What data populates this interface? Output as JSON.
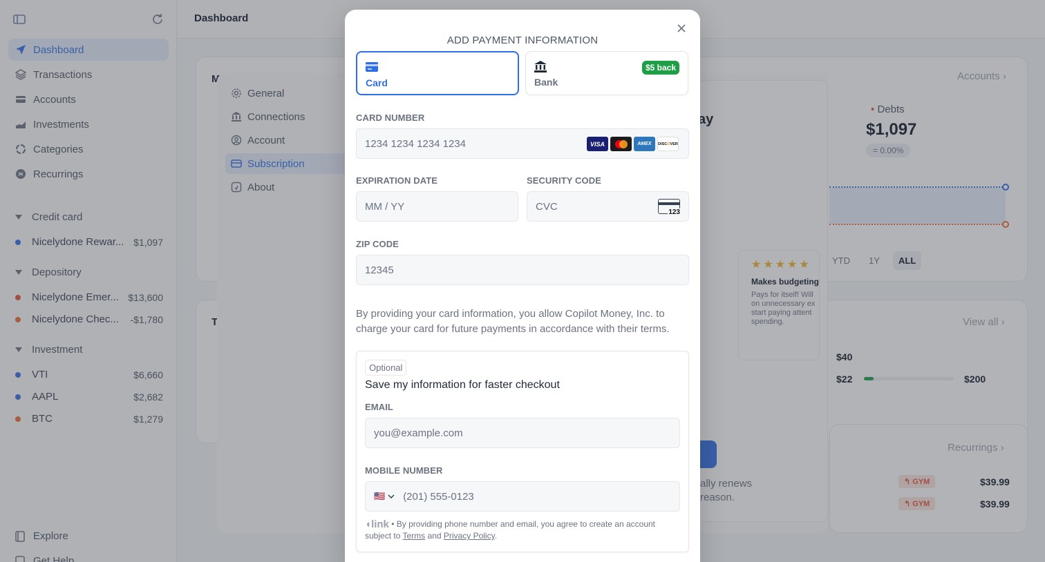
{
  "app": {
    "page_title": "Dashboard",
    "nav": [
      {
        "label": "Dashboard",
        "icon": "paper-plane-icon",
        "active": true
      },
      {
        "label": "Transactions",
        "icon": "layers-icon",
        "active": false
      },
      {
        "label": "Accounts",
        "icon": "card-icon",
        "active": false
      },
      {
        "label": "Investments",
        "icon": "chart-icon",
        "active": false
      },
      {
        "label": "Categories",
        "icon": "categories-icon",
        "active": false
      },
      {
        "label": "Recurrings",
        "icon": "recurring-icon",
        "active": false
      }
    ],
    "groups": [
      {
        "label": "Credit card",
        "accounts": [
          {
            "name": "Nicelydone Rewar...",
            "amount": "$1,097",
            "color": "#2f6fe6"
          }
        ]
      },
      {
        "label": "Depository",
        "accounts": [
          {
            "name": "Nicelydone Emer...",
            "amount": "$13,600",
            "color": "#e5533d"
          },
          {
            "name": "Nicelydone Chec...",
            "amount": "-$1,780",
            "color": "#ef6c2f"
          }
        ]
      },
      {
        "label": "Investment",
        "accounts": [
          {
            "name": "VTI",
            "amount": "$6,660",
            "color": "#2f6fe6"
          },
          {
            "name": "AAPL",
            "amount": "$2,682",
            "color": "#2f6fe6"
          },
          {
            "name": "BTC",
            "amount": "$1,279",
            "color": "#ef6c2f"
          }
        ]
      }
    ],
    "bottom": [
      {
        "label": "Explore"
      },
      {
        "label": "Get Help"
      }
    ],
    "bg": {
      "accounts_link": "Accounts",
      "debts_label": "Debts",
      "debts_value": "$1,097",
      "debts_change": "= 0.00%",
      "ranges": [
        "YTD",
        "1Y",
        "ALL"
      ],
      "view_all": "View all",
      "budget_left": "$40",
      "budget_spent": "$22",
      "budget_total": "$200",
      "recurrings_link": "Recurrings",
      "recurrings": [
        {
          "tag": "GYM",
          "amount": "$39.99"
        },
        {
          "tag": "GYM",
          "amount": "$39.99"
        }
      ],
      "review_title": "Makes budgeting",
      "review_body": "Pays for itself! Will on unnecessary ex start paying attent spending.",
      "stars": "★★★★★",
      "frag_ay": "ay",
      "frag_renews": "ally renews",
      "frag_reason": "reason.",
      "frag_m": "M",
      "frag_t": "T"
    }
  },
  "settings": {
    "items": [
      {
        "label": "General",
        "icon": "gear-icon"
      },
      {
        "label": "Connections",
        "icon": "bank-icon"
      },
      {
        "label": "Account",
        "icon": "user-circle-icon"
      },
      {
        "label": "Subscription",
        "icon": "card-icon",
        "active": true
      },
      {
        "label": "About",
        "icon": "info-icon"
      }
    ]
  },
  "modal": {
    "title": "ADD PAYMENT INFORMATION",
    "tabs": {
      "card": {
        "label": "Card",
        "icon": "credit-card-icon",
        "selected": true
      },
      "bank": {
        "label": "Bank",
        "icon": "bank-icon",
        "badge": "$5 back"
      }
    },
    "card_number": {
      "label": "CARD NUMBER",
      "placeholder": "1234 1234 1234 1234",
      "brands": [
        "VISA",
        "Mastercard",
        "AMEX",
        "DISCOVER"
      ]
    },
    "expiration": {
      "label": "EXPIRATION DATE",
      "placeholder": "MM / YY"
    },
    "security": {
      "label": "SECURITY CODE",
      "placeholder": "CVC",
      "icon_text": "123"
    },
    "zip": {
      "label": "ZIP CODE",
      "placeholder": "12345"
    },
    "consent": "By providing your card information, you allow Copilot Money, Inc. to charge your card for future payments in accordance with their terms.",
    "link": {
      "optional": "Optional",
      "heading": "Save my information for faster checkout",
      "email_label": "EMAIL",
      "email_placeholder": "you@example.com",
      "mobile_label": "MOBILE NUMBER",
      "mobile_placeholder": "(201) 555-0123",
      "country": "🇺🇸",
      "brand": "link",
      "fine_prefix": "By providing phone number and email, you agree to create an account subject to",
      "terms": "Terms",
      "and": "and",
      "privacy": "Privacy Policy"
    }
  }
}
